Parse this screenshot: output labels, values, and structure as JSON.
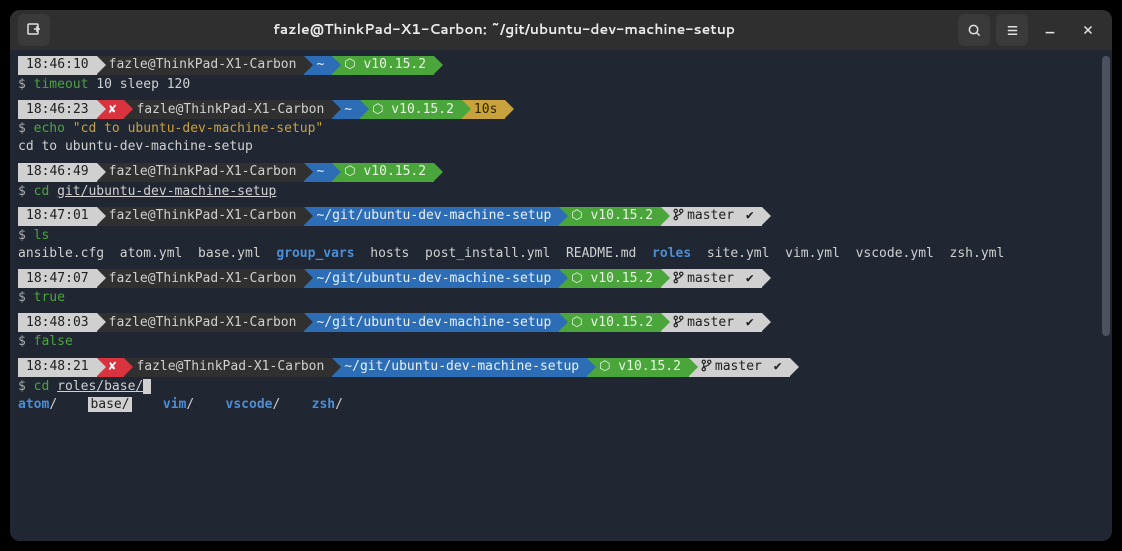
{
  "titlebar": {
    "title": "fazle@ThinkPad-X1-Carbon: ~/git/ubuntu-dev-machine-setup"
  },
  "node_version": "⬡ v10.15.2",
  "blocks": [
    {
      "time": "18:46:10",
      "fail": false,
      "host": "fazle@ThinkPad-X1-Carbon",
      "path": "~",
      "node": true,
      "dur": null,
      "git": null,
      "cmd": "timeout",
      "args": "10 sleep 120",
      "argclass": "arg",
      "out": null
    },
    {
      "time": "18:46:23",
      "fail": true,
      "host": "fazle@ThinkPad-X1-Carbon",
      "path": "~",
      "node": true,
      "dur": "10s",
      "git": null,
      "cmd": "echo",
      "args": "\"cd to ubuntu-dev-machine-setup\"",
      "argclass": "str",
      "out": "cd to ubuntu-dev-machine-setup"
    },
    {
      "time": "18:46:49",
      "fail": false,
      "host": "fazle@ThinkPad-X1-Carbon",
      "path": "~",
      "node": true,
      "dur": null,
      "git": null,
      "cmd": "cd",
      "args": "git/ubuntu-dev-machine-setup",
      "argclass": "arg underline",
      "out": null
    },
    {
      "time": "18:47:01",
      "fail": false,
      "host": "fazle@ThinkPad-X1-Carbon",
      "path": "~/git/ubuntu-dev-machine-setup",
      "node": true,
      "dur": null,
      "git": "master ",
      "cmd": "ls",
      "args": "",
      "argclass": "arg",
      "ls": [
        {
          "n": "ansible.cfg",
          "d": false
        },
        {
          "n": "atom.yml",
          "d": false
        },
        {
          "n": "base.yml",
          "d": false
        },
        {
          "n": "group_vars",
          "d": true
        },
        {
          "n": "hosts",
          "d": false
        },
        {
          "n": "post_install.yml",
          "d": false
        },
        {
          "n": "README.md",
          "d": false
        },
        {
          "n": "roles",
          "d": true
        },
        {
          "n": "site.yml",
          "d": false
        },
        {
          "n": "vim.yml",
          "d": false
        },
        {
          "n": "vscode.yml",
          "d": false
        },
        {
          "n": "zsh.yml",
          "d": false
        }
      ]
    },
    {
      "time": "18:47:07",
      "fail": false,
      "host": "fazle@ThinkPad-X1-Carbon",
      "path": "~/git/ubuntu-dev-machine-setup",
      "node": true,
      "dur": null,
      "git": "master ",
      "cmd": "true",
      "args": "",
      "argclass": "arg",
      "out": null
    },
    {
      "time": "18:48:03",
      "fail": false,
      "host": "fazle@ThinkPad-X1-Carbon",
      "path": "~/git/ubuntu-dev-machine-setup",
      "node": true,
      "dur": null,
      "git": "master ",
      "cmd": "false",
      "args": "",
      "argclass": "arg",
      "out": null
    },
    {
      "time": "18:48:21",
      "fail": true,
      "host": "fazle@ThinkPad-X1-Carbon",
      "path": "~/git/ubuntu-dev-machine-setup",
      "node": true,
      "dur": null,
      "git": "master ",
      "cmd": "cd",
      "args": "roles/base/",
      "argclass": "arg underline",
      "cursor": true,
      "tabcomp": [
        {
          "n": "atom",
          "sel": false
        },
        {
          "n": "base",
          "sel": true
        },
        {
          "n": "vim",
          "sel": false
        },
        {
          "n": "vscode",
          "sel": false
        },
        {
          "n": "zsh",
          "sel": false
        }
      ]
    }
  ]
}
